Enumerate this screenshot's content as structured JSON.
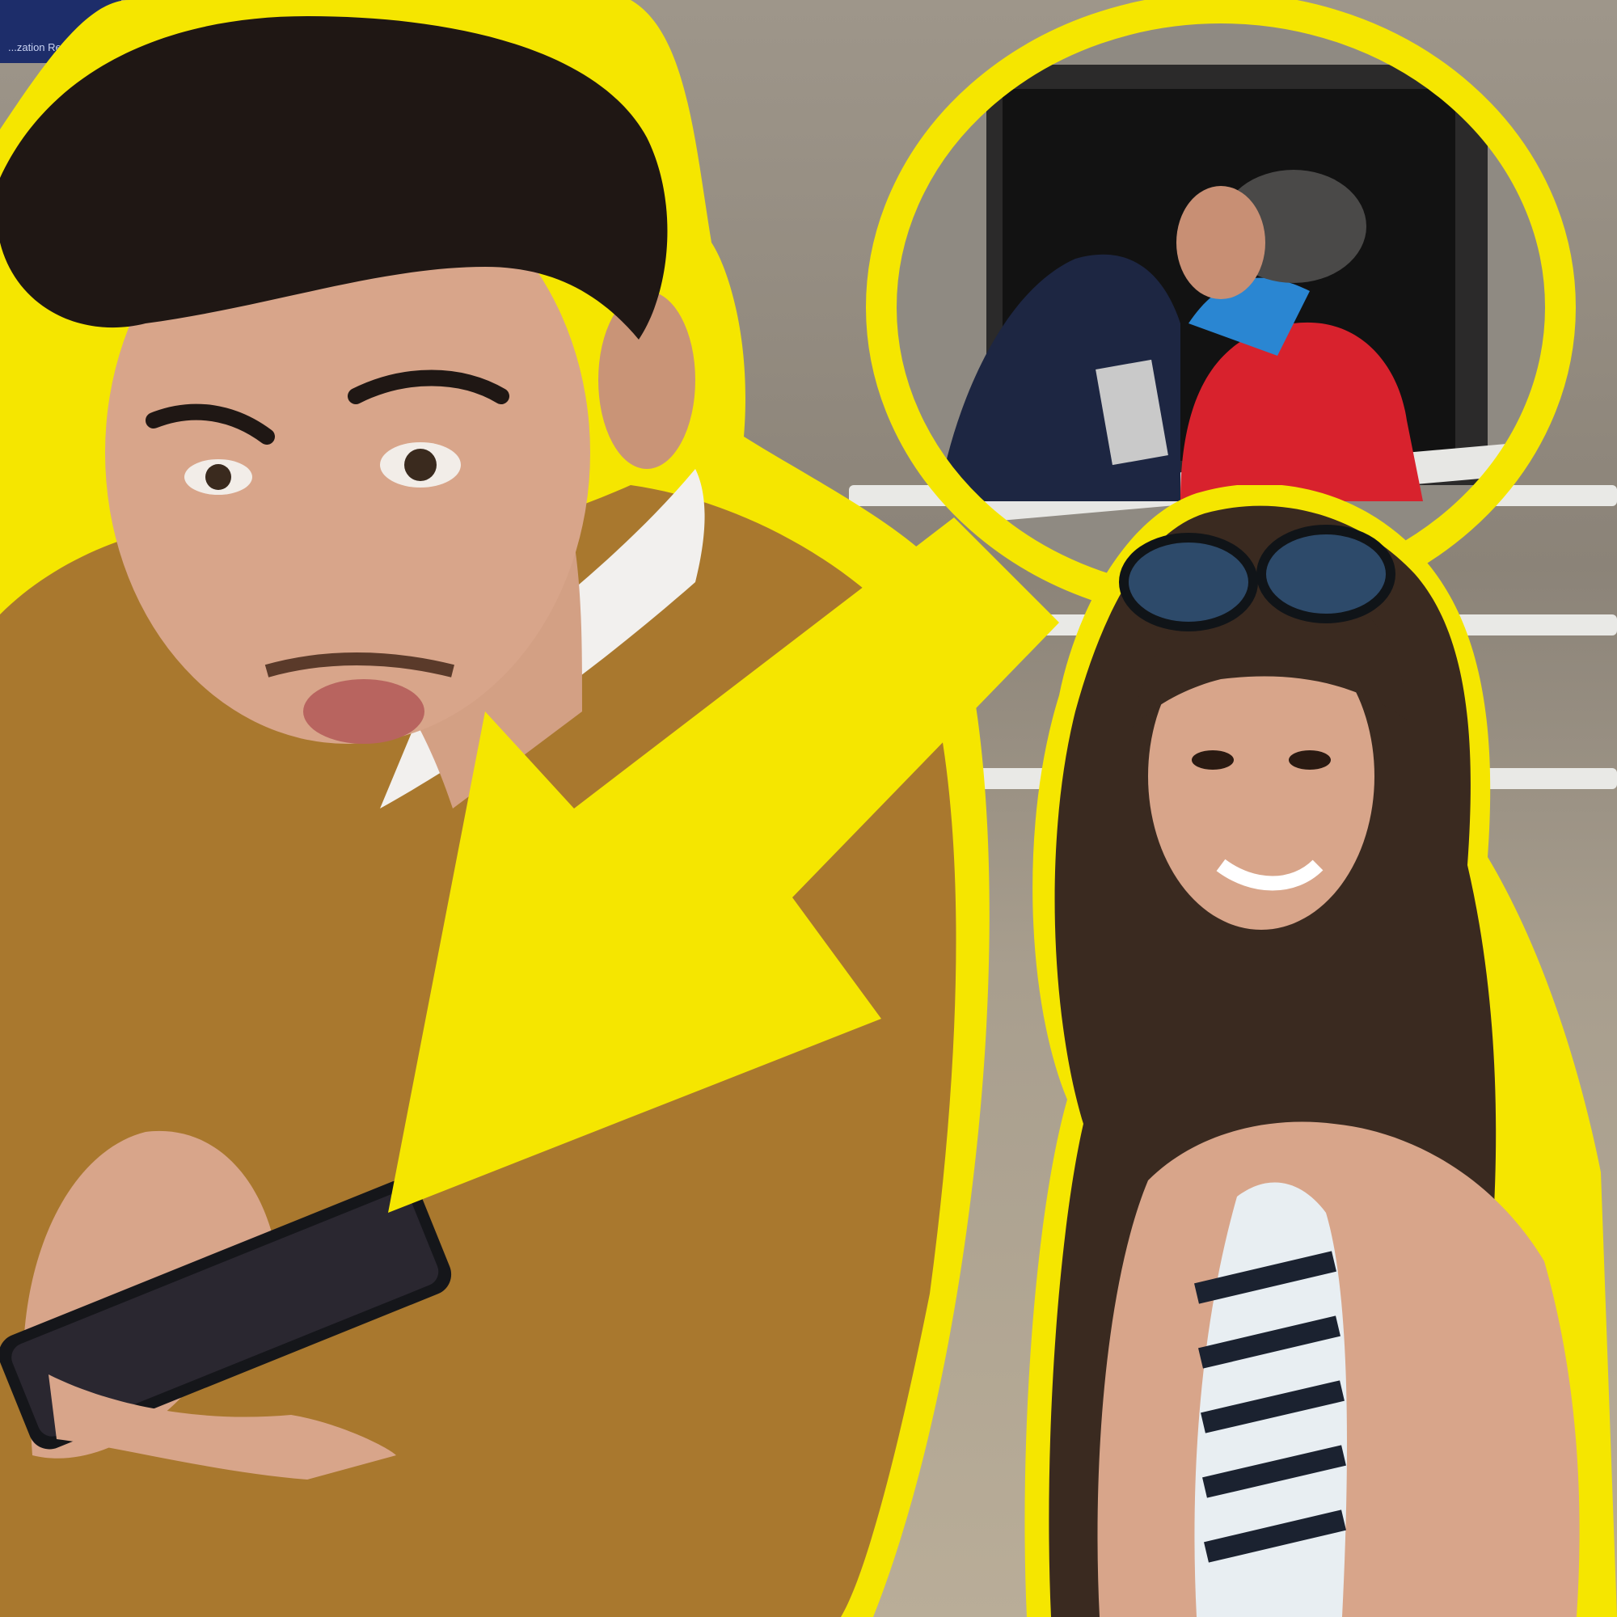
{
  "image": {
    "sign_text": "...zation Reactor",
    "colors": {
      "outline": "#f5e600",
      "sweater": "#a9782e",
      "collar": "#f2f0ee",
      "hair": "#1f1714",
      "skin": "#d8a58a",
      "zebra_dark": "#1b2230",
      "zebra_light": "#e8eef2",
      "red_jacket": "#d8222d",
      "navy_jacket": "#1d2642",
      "phone": "#15161a"
    },
    "icons": {
      "arrow": "yellow-arrow-icon",
      "circle": "highlight-circle-icon",
      "phone": "phone-icon"
    }
  }
}
